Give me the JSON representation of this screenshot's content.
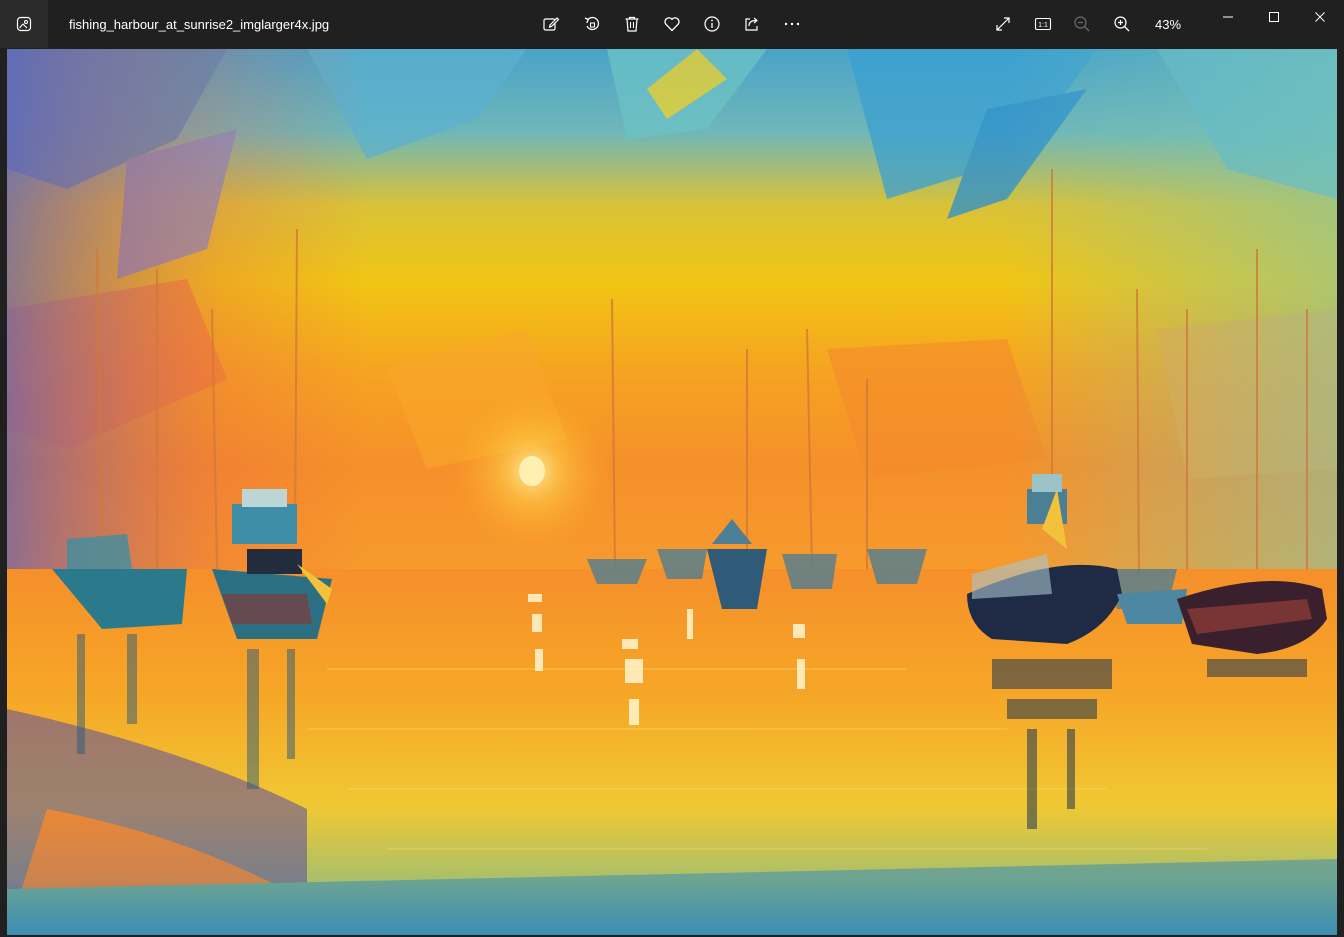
{
  "window": {
    "file_name": "fishing_harbour_at_sunrise2_imglarger4x.jpg",
    "zoom_level": "43%"
  },
  "toolbar": {
    "icons": [
      "edit-icon",
      "rotate-icon",
      "delete-icon",
      "favorite-icon",
      "info-icon",
      "share-icon",
      "more-icon"
    ],
    "view_icons": [
      "fullscreen-icon",
      "actual-size-icon",
      "zoom-out-icon",
      "zoom-in-icon"
    ],
    "actual_size_label": "1:1"
  },
  "window_controls": [
    "minimize-icon",
    "maximize-icon",
    "close-icon"
  ],
  "colors": {
    "titlebar_bg": "#202020",
    "sky_blue": "#4fa6c9",
    "sunrise_yellow": "#f2c618",
    "sunrise_orange": "#f59a1e",
    "water_orange": "#f7a629",
    "boat_dark": "#1f2a44"
  }
}
